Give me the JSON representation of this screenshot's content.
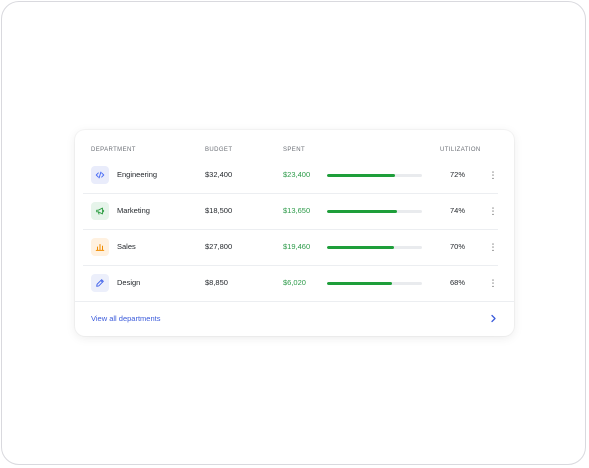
{
  "table": {
    "headers": {
      "department": "DEPARTMENT",
      "budget": "BUDGET",
      "spent": "SPENT",
      "utilization": "UTILIZATION"
    },
    "rows": [
      {
        "name": "Engineering",
        "budget": "$32,400",
        "spent": "$23,400",
        "utilization": "72%",
        "utilization_fraction": 0.72,
        "icon": "code-icon",
        "icon_color": "#4c6ef5",
        "icon_bg": "#e9ecfb",
        "bar_color": "#1e9e3a"
      },
      {
        "name": "Marketing",
        "budget": "$18,500",
        "spent": "$13,650",
        "utilization": "74%",
        "utilization_fraction": 0.74,
        "icon": "megaphone-icon",
        "icon_color": "#2f9e44",
        "icon_bg": "#e6f4ea",
        "bar_color": "#1e9e3a"
      },
      {
        "name": "Sales",
        "budget": "$27,800",
        "spent": "$19,460",
        "utilization": "70%",
        "utilization_fraction": 0.7,
        "icon": "bar-chart-icon",
        "icon_color": "#f08c00",
        "icon_bg": "#fff1e0",
        "bar_color": "#1e9e3a"
      },
      {
        "name": "Design",
        "budget": "$8,850",
        "spent": "$6,020",
        "utilization": "68%",
        "utilization_fraction": 0.68,
        "icon": "pen-icon",
        "icon_color": "#4263eb",
        "icon_bg": "#eceffb",
        "bar_color": "#1e9e3a"
      }
    ],
    "spent_color": "#2b9a48",
    "row_menu_icon": "more-vertical-icon"
  },
  "footer": {
    "link_label": "View all departments",
    "link_color": "#3b5bdb",
    "chevron_icon": "chevron-right-icon"
  }
}
